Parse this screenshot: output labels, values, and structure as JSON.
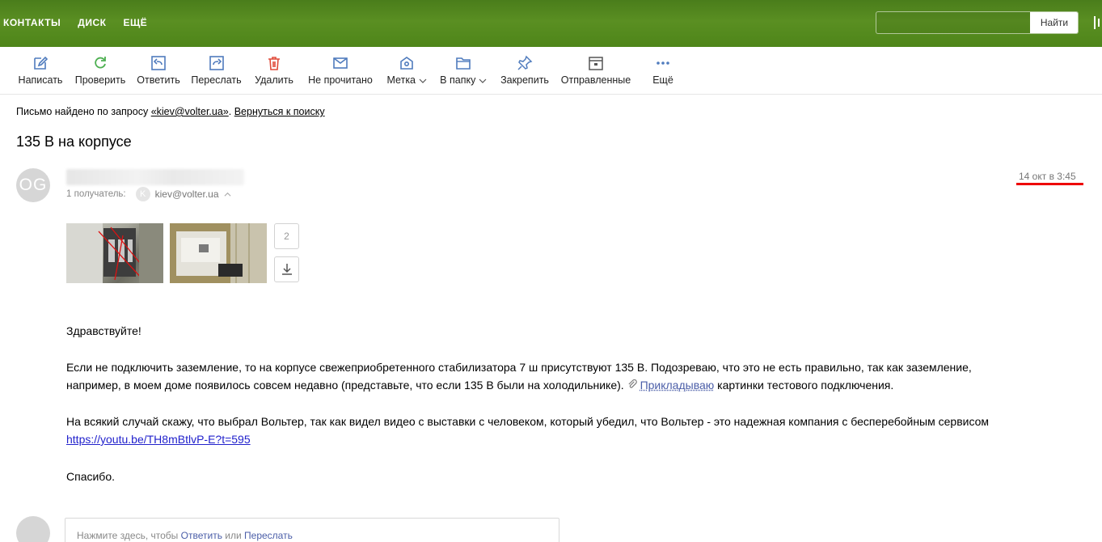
{
  "topnav": {
    "contacts": "КОНТАКТЫ",
    "disk": "ДИСК",
    "more": "ЕЩЁ"
  },
  "search": {
    "placeholder": "",
    "button": "Найти"
  },
  "toolbar": {
    "compose": "Написать",
    "check": "Проверить",
    "reply": "Ответить",
    "forward": "Переслать",
    "delete": "Удалить",
    "unread": "Не прочитано",
    "label": "Метка",
    "to_folder": "В папку",
    "pin": "Закрепить",
    "sent": "Отправленные",
    "more": "Ещё"
  },
  "notice": {
    "prefix": "Письмо найдено по запросу ",
    "query": "«kiev@volter.ua»",
    "sep": ". ",
    "back": "Вернуться к поиску"
  },
  "message": {
    "subject": "135 В на корпусе",
    "sender_initials": "OG",
    "recipients_label": "1 получатель:",
    "recipient_initial": "K",
    "recipient_email": "kiev@volter.ua",
    "date": "14 окт в 3:45",
    "attachments_more": "2",
    "greeting": "Здравствуйте!",
    "para1_a": "Если не подключить заземление, то на корпусе свежеприобретенного стабилизатора 7 ш присутствуют 135 В. Подозреваю, что это не есть правильно, так как заземление,",
    "para1_b": "например, в моем доме появилось совсем недавно (представьте, что если 135 В были на холодильнике).",
    "para1_link": "Прикладываю",
    "para1_c": " картинки тестового подключения.",
    "para2_a": "На всякий случай скажу, что выбрал Вольтер, так как видел видео с выставки с человеком, который убедил, что Вольтер - это надежная компания с бесперебойным сервисом",
    "para2_url": "https://youtu.be/TH8mBtlvP-E?t=595",
    "thanks": "Спасибо."
  },
  "reply": {
    "prefix": "Нажмите здесь, чтобы ",
    "reply_link": "Ответить",
    "or": " или ",
    "forward_link": "Переслать"
  },
  "colors": {
    "topbar": "#52891e",
    "accent_link": "#4b5ea8",
    "highlight": "#ee0000"
  },
  "icons": [
    "compose-icon",
    "refresh-icon",
    "reply-icon",
    "forward-icon",
    "trash-icon",
    "envelope-icon",
    "label-icon",
    "folder-icon",
    "pin-icon",
    "sent-icon",
    "more-dots-icon",
    "download-icon",
    "paperclip-icon"
  ]
}
